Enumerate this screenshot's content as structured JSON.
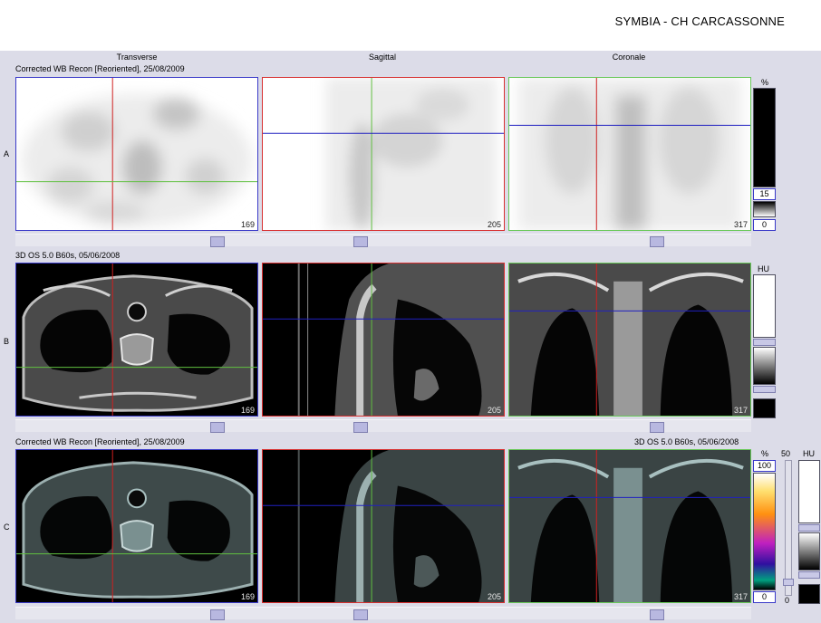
{
  "header": {
    "site_title": "SYMBIA - CH CARCASSONNE"
  },
  "columns": {
    "transverse": "Transverse",
    "sagittal": "Sagittal",
    "coronal": "Coronale"
  },
  "rows": {
    "a": {
      "label": "A",
      "caption": "Corrected WB Recon [Reoriented], 25/08/2009"
    },
    "b": {
      "label": "B",
      "caption": "3D  OS  5.0  B60s, 05/06/2008"
    },
    "c": {
      "label": "C",
      "caption_left": "Corrected WB Recon [Reoriented], 25/08/2009",
      "caption_right": "3D  OS  5.0  B60s, 05/06/2008"
    }
  },
  "slices": {
    "transverse": "169",
    "sagittal": "205",
    "coronal": "317"
  },
  "scales": {
    "a": {
      "unit": "%",
      "top_value": "15",
      "bottom_value": "0"
    },
    "b": {
      "unit": "HU"
    },
    "c": {
      "unit_pct": "%",
      "top_value": "100",
      "bottom_value": "0",
      "slider_top": "50",
      "slider_bottom": "0",
      "unit_hu": "HU"
    }
  },
  "colors": {
    "crosshair_vertical": "#d02020",
    "crosshair_horizontal_a": "#60c040",
    "crosshair_horizontal_b": "#2020c0",
    "border_transverse": "#3a3ac8",
    "border_sagittal": "#d83030",
    "border_coronal": "#68c858"
  }
}
